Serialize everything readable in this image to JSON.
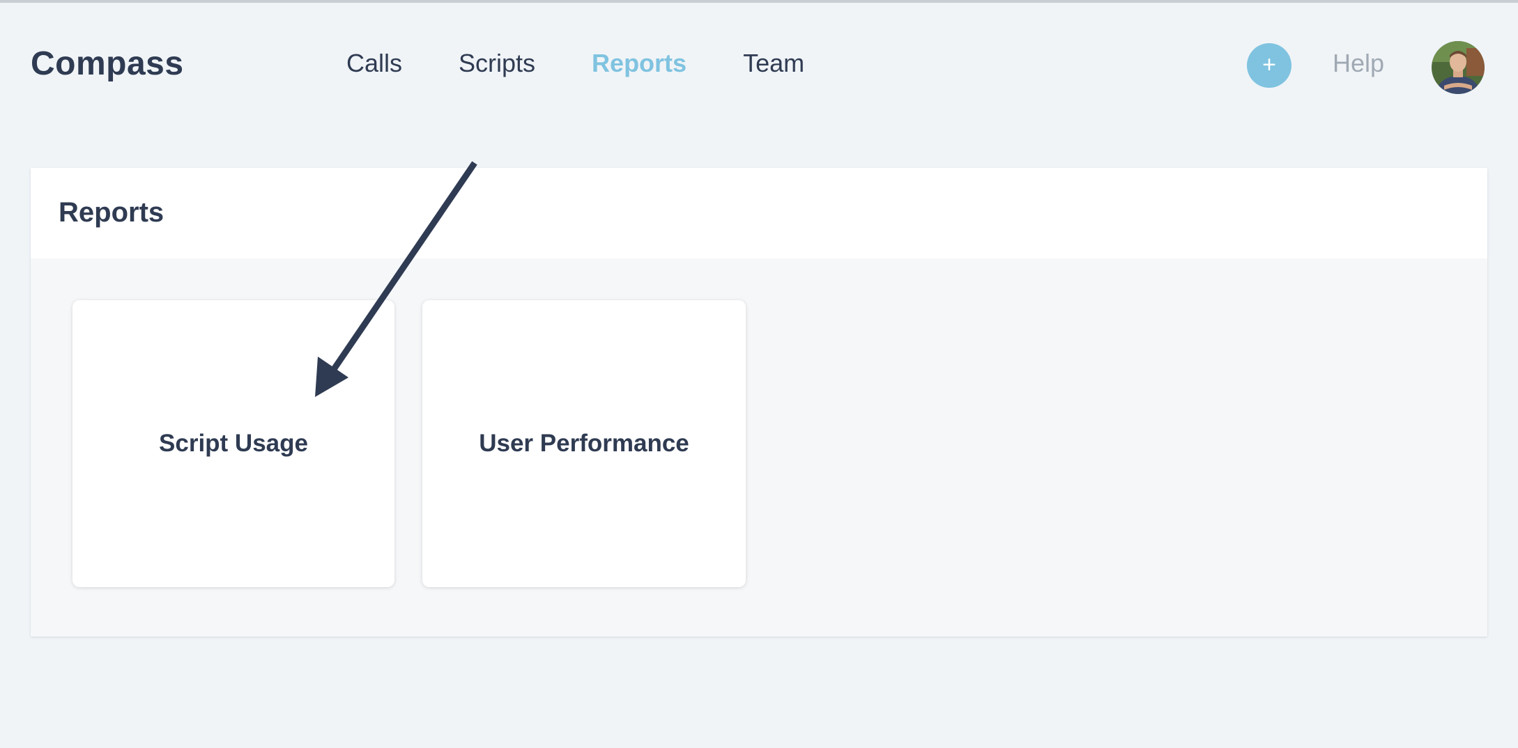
{
  "app": {
    "title": "Compass"
  },
  "nav": {
    "items": [
      {
        "label": "Calls",
        "active": false
      },
      {
        "label": "Scripts",
        "active": false
      },
      {
        "label": "Reports",
        "active": true
      },
      {
        "label": "Team",
        "active": false
      }
    ]
  },
  "header_actions": {
    "add_label": "+",
    "help_label": "Help",
    "avatar_icon": "user-avatar-photo"
  },
  "reports": {
    "title": "Reports",
    "cards": [
      {
        "label": "Script Usage"
      },
      {
        "label": "User Performance"
      }
    ]
  },
  "annotation": {
    "icon": "arrow-annotation-icon",
    "points_to": "Script Usage"
  },
  "colors": {
    "accent": "#7fc3e0",
    "text": "#2f3b52",
    "muted": "#a0a9b3",
    "background": "#f0f4f7"
  }
}
